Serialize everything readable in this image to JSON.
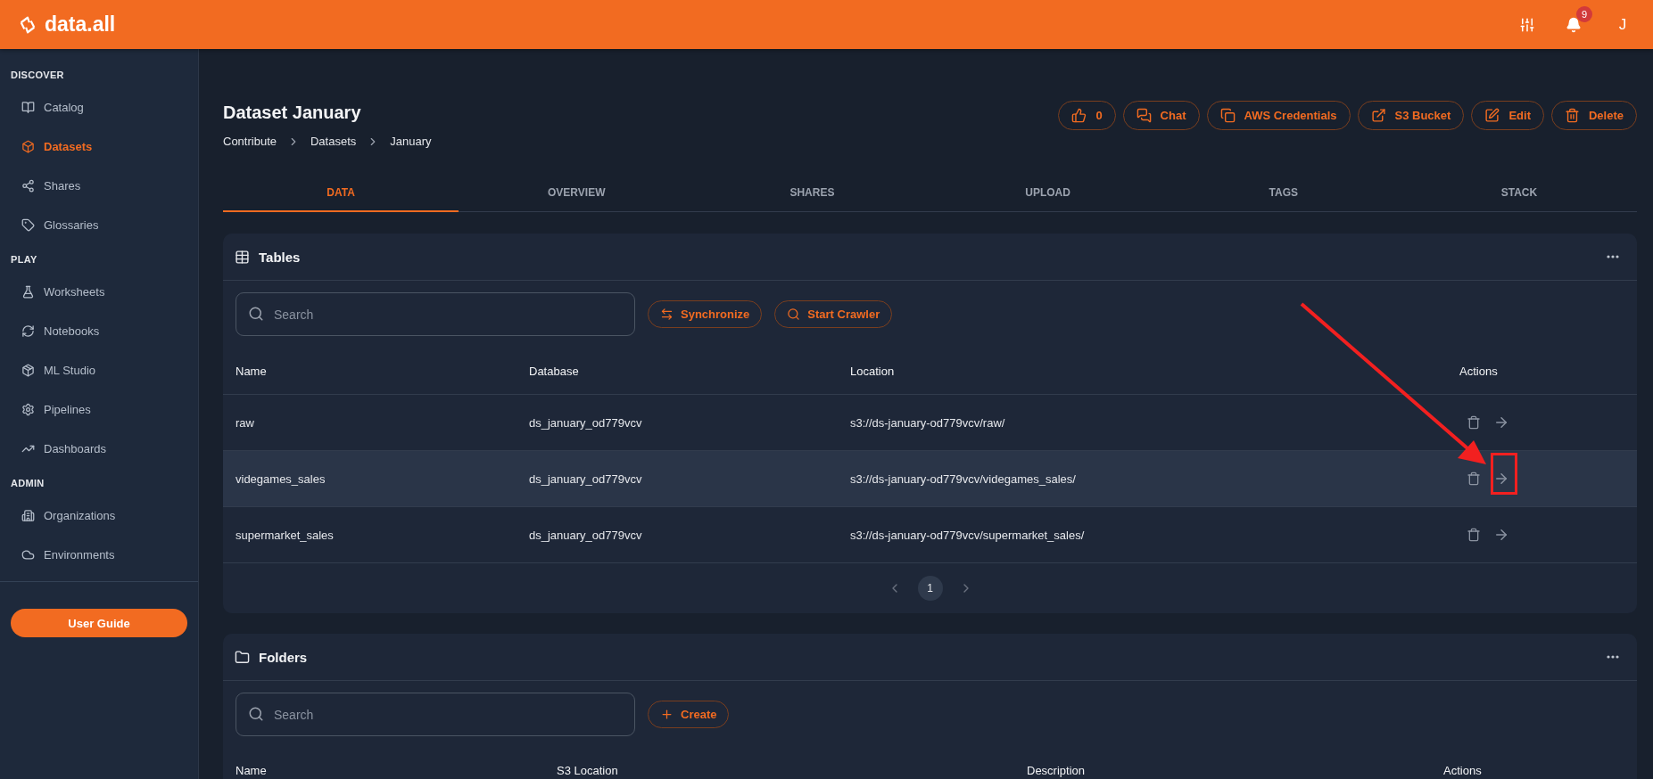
{
  "topbar": {
    "logo_text": "data.all",
    "notification_count": "9",
    "user_initial": "J"
  },
  "sidebar": {
    "sections": [
      {
        "title": "DISCOVER",
        "items": [
          {
            "label": "Catalog",
            "selected": false
          },
          {
            "label": "Datasets",
            "selected": true
          },
          {
            "label": "Shares",
            "selected": false
          },
          {
            "label": "Glossaries",
            "selected": false
          }
        ]
      },
      {
        "title": "PLAY",
        "items": [
          {
            "label": "Worksheets",
            "selected": false
          },
          {
            "label": "Notebooks",
            "selected": false
          },
          {
            "label": "ML Studio",
            "selected": false
          },
          {
            "label": "Pipelines",
            "selected": false
          },
          {
            "label": "Dashboards",
            "selected": false
          }
        ]
      },
      {
        "title": "ADMIN",
        "items": [
          {
            "label": "Organizations",
            "selected": false
          },
          {
            "label": "Environments",
            "selected": false
          }
        ]
      }
    ],
    "guide_button": "User Guide"
  },
  "page": {
    "title": "Dataset January",
    "breadcrumb": [
      "Contribute",
      "Datasets",
      "January"
    ],
    "actions": [
      "0",
      "Chat",
      "AWS Credentials",
      "S3 Bucket",
      "Edit",
      "Delete"
    ]
  },
  "tabs": [
    {
      "label": "DATA",
      "selected": true
    },
    {
      "label": "OVERVIEW",
      "selected": false
    },
    {
      "label": "SHARES",
      "selected": false
    },
    {
      "label": "UPLOAD",
      "selected": false
    },
    {
      "label": "TAGS",
      "selected": false
    },
    {
      "label": "STACK",
      "selected": false
    }
  ],
  "tables_card": {
    "title": "Tables",
    "search": {
      "placeholder": "Search"
    },
    "buttons": [
      "Synchronize",
      "Start Crawler"
    ],
    "columns": [
      "Name",
      "Database",
      "Location",
      "Actions"
    ],
    "rows": [
      {
        "name": "raw",
        "database": "ds_january_od779vcv",
        "location": "s3://ds-january-od779vcv/raw/",
        "highlighted": false
      },
      {
        "name": "videgames_sales",
        "database": "ds_january_od779vcv",
        "location": "s3://ds-january-od779vcv/videgames_sales/",
        "highlighted": true
      },
      {
        "name": "supermarket_sales",
        "database": "ds_january_od779vcv",
        "location": "s3://ds-january-od779vcv/supermarket_sales/",
        "highlighted": false
      }
    ],
    "pages": [
      {
        "label": "1",
        "selected": true
      }
    ]
  },
  "folders_card": {
    "title": "Folders",
    "search": {
      "placeholder": "Search"
    },
    "buttons": [
      "Create"
    ],
    "columns": [
      "Name",
      "S3 Location",
      "Description",
      "Actions"
    ]
  }
}
